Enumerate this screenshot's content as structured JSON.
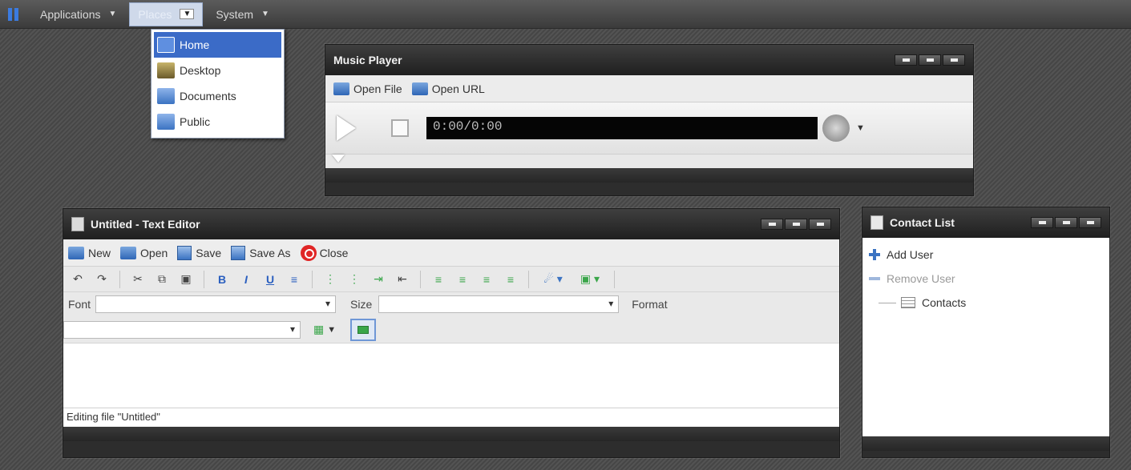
{
  "panel": {
    "menus": [
      {
        "label": "Applications"
      },
      {
        "label": "Places"
      },
      {
        "label": "System"
      }
    ]
  },
  "places_menu": {
    "items": [
      {
        "label": "Home",
        "color": "#3b6bc7"
      },
      {
        "label": "Desktop",
        "color": "#7a6a3a"
      },
      {
        "label": "Documents",
        "color": "#3b7be0"
      },
      {
        "label": "Public",
        "color": "#4a7fd0"
      }
    ]
  },
  "music_player": {
    "title": "Music Player",
    "open_file": "Open File",
    "open_url": "Open URL",
    "time": "0:00/0:00"
  },
  "text_editor": {
    "title": "Untitled - Text Editor",
    "toolbar": {
      "new": "New",
      "open": "Open",
      "save": "Save",
      "save_as": "Save As",
      "close": "Close"
    },
    "font_label": "Font",
    "size_label": "Size",
    "format_label": "Format",
    "bold": "B",
    "italic": "I",
    "underline": "U",
    "status": "Editing file \"Untitled\""
  },
  "contact_list": {
    "title": "Contact List",
    "add_user": "Add User",
    "remove_user": "Remove User",
    "contacts": "Contacts"
  },
  "colors": {
    "accent": "#3b6bc7",
    "desktop_bg": "#4a4a4a",
    "close_red": "#e02525"
  }
}
